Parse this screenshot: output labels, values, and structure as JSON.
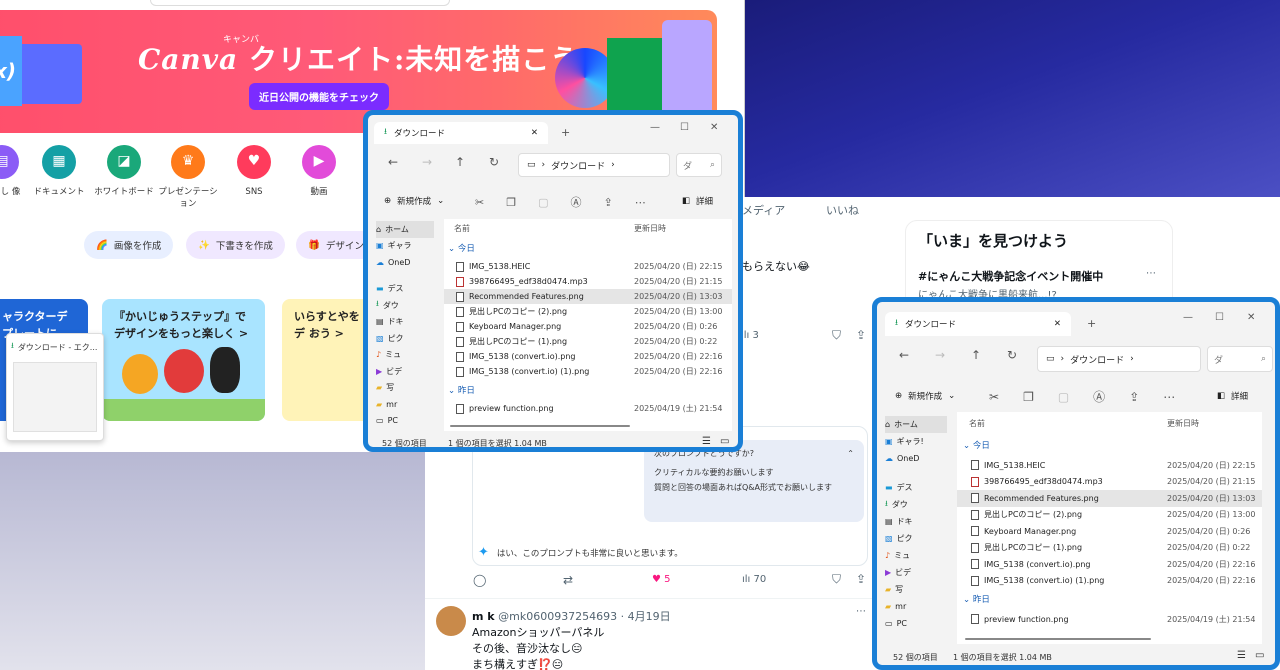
{
  "canva": {
    "banner_title_prefix": "Canva",
    "banner_title_suffix": "クリエイト:未知を描こう",
    "banner_ruby": "キャンバ",
    "banner_button": "近日公開の機能をチェック",
    "banner_left_text": "x)",
    "categories": [
      {
        "label": "見出し 像",
        "color": "#8b5cf6",
        "icon": "book"
      },
      {
        "label": "ドキュメント",
        "color": "#14a0a5",
        "icon": "doc"
      },
      {
        "label": "ホワイトボード",
        "color": "#1aa87a",
        "icon": "board"
      },
      {
        "label": "プレゼンテーション",
        "color": "#ff7a1a",
        "icon": "present"
      },
      {
        "label": "SNS",
        "color": "#ff3b5c",
        "icon": "heart"
      },
      {
        "label": "動画",
        "color": "#e24bd9",
        "icon": "video"
      }
    ],
    "pills": [
      "画像を作成",
      "下書きを作成",
      "デザイン"
    ],
    "cards": [
      {
        "title": "ャラクターデ プレートに",
        "color": "#1f66d6"
      },
      {
        "title": "『かいじゅうステップ』で デザインをもっと楽しく >",
        "color": "#a9e4ff"
      },
      {
        "title": "いらすとやをデ おう >",
        "color": "#fff3b8"
      }
    ],
    "thumb_label": "ダウンロード - エク..."
  },
  "twitter": {
    "tabs": [
      "メディア",
      "いいね"
    ],
    "tweet_text": "もらえない😂",
    "analytics_count_a": "3",
    "ai_question": "次のプロンプトどうですか?",
    "ai_bubble_lines": [
      "クリティカルな要約お願いします",
      "質問と回答の場面あればQ&A形式でお願いします"
    ],
    "ai_reply": "はい、このプロンプトも非常に良いと思います。",
    "likes": "5",
    "views": "70",
    "user_name": "m k",
    "user_handle": "@mk0600937254693 · 4月19日",
    "post_lines": [
      "Amazonショッパーパネル",
      "その後、音沙汰なし😑",
      "まち構えすぎ⁉️😑"
    ],
    "trends_title": "「いま」を見つけよう",
    "trend_tag": "#にゃんこ大戦争記念イベント開催中",
    "trend_sub": "にゃんこ大戦争に黒船来航...!?"
  },
  "explorer": {
    "tab_title": "ダウンロード",
    "address": "ダウンロード",
    "search_placeholder": "ダ",
    "new_label": "新規作成",
    "details_label": "詳細",
    "col_name": "名前",
    "col_date": "更新日時",
    "group_today": "今日",
    "group_yesterday": "昨日",
    "status_count": "52 個の項目",
    "status_selected": "1 個の項目を選択  1.04 MB",
    "sidebar_a": [
      "ホーム",
      "ギャラ",
      "OneD",
      "デス",
      "ダウ",
      "ドキ",
      "ピク",
      "ミュ",
      "ビデ",
      "写",
      "mr",
      "PC"
    ],
    "sidebar_b": [
      "ホーム",
      "ギャラ!",
      "OneD",
      "デス",
      "ダウ",
      "ドキ",
      "ピク",
      "ミュ",
      "ビデ",
      "写",
      "mr",
      "PC"
    ],
    "files": [
      {
        "name": "IMG_5138.HEIC",
        "date": "2025/04/20 (日) 22:15",
        "type": "img"
      },
      {
        "name": "398766495_edf38d0474.mp3",
        "date": "2025/04/20 (日) 21:15",
        "type": "mp3"
      },
      {
        "name": "Recommended Features.png",
        "date": "2025/04/20 (日) 13:03",
        "type": "img"
      },
      {
        "name": "見出しPCのコピー (2).png",
        "date": "2025/04/20 (日) 13:00",
        "type": "img"
      },
      {
        "name": "Keyboard Manager.png",
        "date": "2025/04/20 (日) 0:26",
        "type": "img"
      },
      {
        "name": "見出しPCのコピー (1).png",
        "date": "2025/04/20 (日) 0:22",
        "type": "img"
      },
      {
        "name": "IMG_5138 (convert.io).png",
        "date": "2025/04/20 (日) 22:16",
        "type": "img"
      },
      {
        "name": "IMG_5138 (convert.io) (1).png",
        "date": "2025/04/20 (日) 22:16",
        "type": "img"
      }
    ],
    "yesterday_file": {
      "name": "preview function.png",
      "date": "2025/04/19 (土) 21:54"
    }
  },
  "colors": {
    "accent": "#1a7fd6",
    "canva_purple": "#7b2cff",
    "like_pink": "#f91880"
  }
}
